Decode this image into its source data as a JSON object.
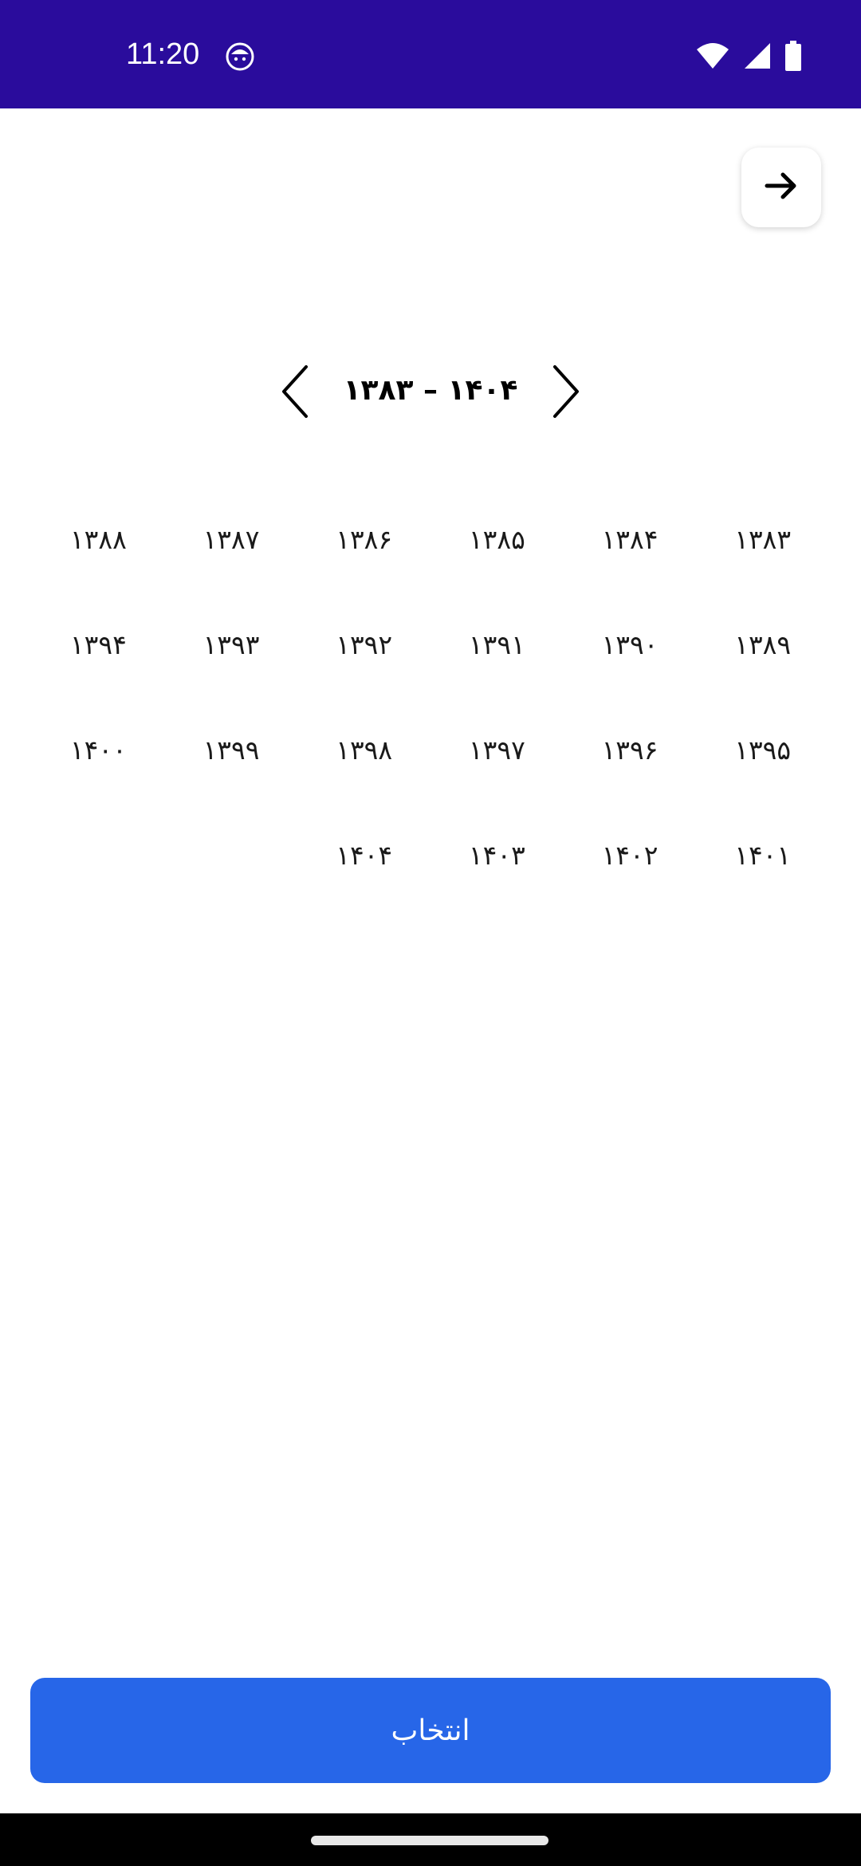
{
  "status_bar": {
    "time": "11:20",
    "notification_icon": "face-notification-icon",
    "wifi_icon": "wifi-icon",
    "signal_icon": "cell-signal-icon",
    "battery_icon": "battery-icon",
    "background_color": "#2a0c9c"
  },
  "header": {
    "back_icon": "arrow-right-icon"
  },
  "range": {
    "title": "۱۳۸۳ – ۱۴۰۴",
    "prev_icon": "chevron-left-icon",
    "next_icon": "chevron-right-icon"
  },
  "years": [
    "۱۳۸۳",
    "۱۳۸۴",
    "۱۳۸۵",
    "۱۳۸۶",
    "۱۳۸۷",
    "۱۳۸۸",
    "۱۳۸۹",
    "۱۳۹۰",
    "۱۳۹۱",
    "۱۳۹۲",
    "۱۳۹۳",
    "۱۳۹۴",
    "۱۳۹۵",
    "۱۳۹۶",
    "۱۳۹۷",
    "۱۳۹۸",
    "۱۳۹۹",
    "۱۴۰۰",
    "۱۴۰۱",
    "۱۴۰۲",
    "۱۴۰۳",
    "۱۴۰۴"
  ],
  "footer": {
    "select_label": "انتخاب",
    "button_color": "#2766e8"
  }
}
